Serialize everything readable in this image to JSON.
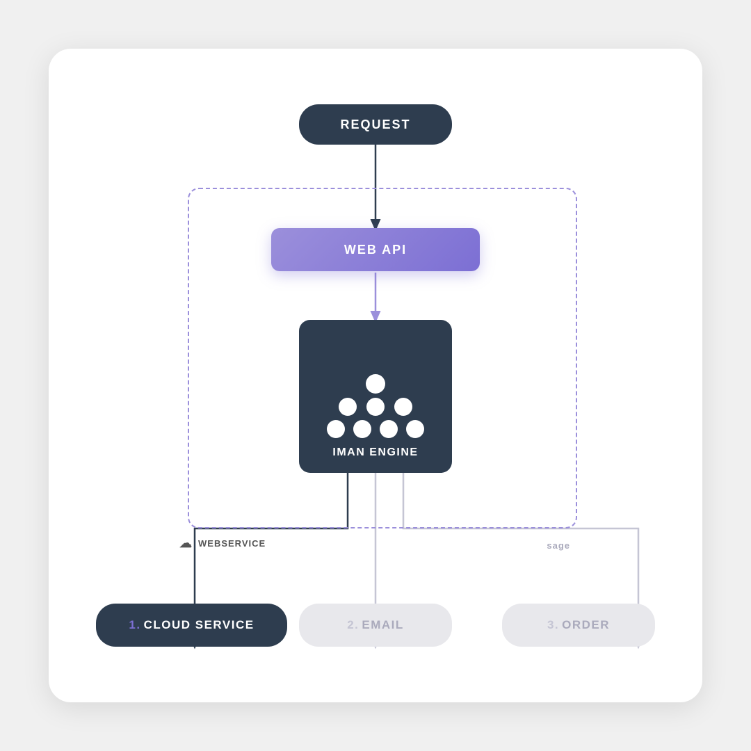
{
  "card": {
    "request_label": "REQUEST",
    "webapi_label": "WEB API",
    "iman_label": "IMAN ENGINE",
    "cloud_num": "1.",
    "cloud_label": "CLOUD SERVICE",
    "email_num": "2.",
    "email_label": "EMAIL",
    "order_num": "3.",
    "order_label": "ORDER",
    "webservice_label": "WEBSERVICE",
    "sage_label": "sage",
    "colors": {
      "dark": "#2e3d4f",
      "purple": "#7c6fd4",
      "purple_light": "#9b8fdb",
      "gray_bg": "#e8e8ec",
      "gray_text": "#aaaabc",
      "arrow_dark": "#2e3d4f",
      "arrow_purple": "#9b8fdb",
      "arrow_gray": "#c5c5d4"
    }
  }
}
